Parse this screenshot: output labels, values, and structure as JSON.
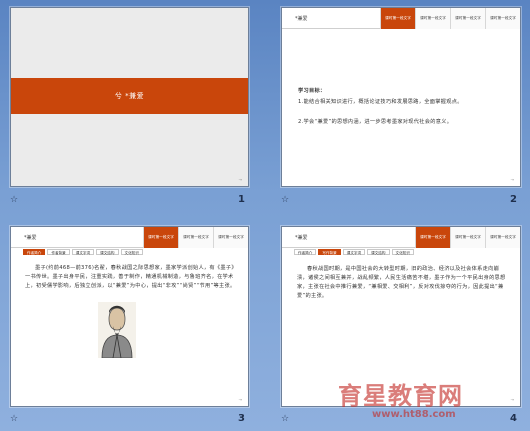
{
  "slides": [
    {
      "number": "1",
      "title": "兮 *兼爱",
      "corner": "→"
    },
    {
      "number": "2",
      "header_title": "*兼爱",
      "tabs": [
        "课时第一段文字",
        "课时第一段文字",
        "课时第一段文字",
        "课时第一段文字"
      ],
      "objectives_title": "学习目标：",
      "objectives": [
        "1.能结合相关知识进行，概括论证技巧和发展思路，全面掌握观点。",
        "2.学会“兼爱”的思想内涵，进一步思考墨家对现代社会的意义。"
      ],
      "corner": "→"
    },
    {
      "number": "3",
      "header_title": "*兼爱",
      "tabs": [
        "课时第一段文字",
        "课时第一段文字",
        "课时第一段文字"
      ],
      "sub_tabs": [
        "作者简介",
        "作者背景",
        "课文字词",
        "课文结构",
        "文化知识"
      ],
      "paragraph": "墨子(约前468—前376)名翟，春秋战国之际思想家，墨家学派创始人，有《墨子》一书传世。墨子出身平民，注重实践，善于制作，精通机械制造，与鲁班齐名，在学术上，初受儒学影响，后独立创派，以“兼爱”为中心，提出“非攻”“尚贤”“节用”等主张。",
      "corner": "→"
    },
    {
      "number": "4",
      "header_title": "*兼爱",
      "tabs": [
        "课时第一段文字",
        "课时第一段文字",
        "课时第一段文字"
      ],
      "sub_tabs": [
        "作者简介",
        "写作背景",
        "课文字词",
        "课文结构",
        "文化知识"
      ],
      "paragraph": "春秋战国时期，是中国社会的大转型时期，旧的政治、经济以及社会体系走向崩溃，诸侯之间相互兼并，战乱频繁，人民生活痛苦不堪，墨子作为一个平民出身的思想家，主张在社会中推行兼爱，“兼相爱、交相利”，反对攻伐掠夺的行为，因此提出“兼爱”的主张。",
      "corner": "→"
    }
  ],
  "watermark": {
    "text": "育星教育网",
    "url": "www.ht88.com"
  }
}
